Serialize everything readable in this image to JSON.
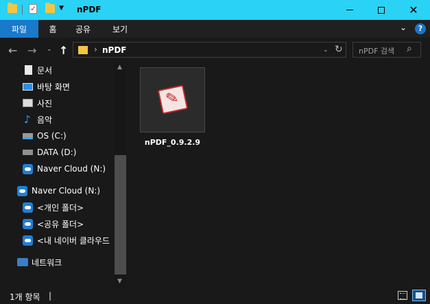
{
  "window": {
    "title": "nPDF",
    "minimize_icon": "minimize-icon",
    "maximize_icon": "maximize-icon",
    "close_glyph": "✕"
  },
  "ribbon": {
    "tabs": [
      "파일",
      "홈",
      "공유",
      "보기"
    ],
    "collapse_glyph": "⌄",
    "help_glyph": "?"
  },
  "address": {
    "back_glyph": "←",
    "forward_glyph": "→",
    "recent_glyph": "⌄",
    "up_glyph": "↑",
    "separator": "›",
    "path": "nPDF",
    "dropdown_glyph": "⌄",
    "refresh_glyph": "↻"
  },
  "search": {
    "placeholder": "nPDF 검색",
    "icon_glyph": "⌕"
  },
  "nav": {
    "items": [
      {
        "label": "문서",
        "icon": "documents-icon"
      },
      {
        "label": "바탕 화면",
        "icon": "desktop-icon"
      },
      {
        "label": "사진",
        "icon": "pictures-icon"
      },
      {
        "label": "음악",
        "icon": "music-icon"
      },
      {
        "label": "OS (C:)",
        "icon": "os-drive-icon"
      },
      {
        "label": "DATA (D:)",
        "icon": "drive-icon"
      },
      {
        "label": "Naver Cloud (N:)",
        "icon": "naver-cloud-icon"
      },
      {
        "label": "Naver Cloud (N:)",
        "icon": "naver-cloud-icon"
      },
      {
        "label": "<개인 폴더>",
        "icon": "naver-cloud-folder-icon"
      },
      {
        "label": "<공유 폴더>",
        "icon": "naver-cloud-folder-icon"
      },
      {
        "label": "<내 네이버 클라우드",
        "icon": "naver-cloud-info-icon"
      },
      {
        "label": "네트워크",
        "icon": "network-icon"
      }
    ],
    "music_glyph": "♪"
  },
  "scrollbar": {
    "up_glyph": "▲",
    "down_glyph": "▼"
  },
  "files": [
    {
      "name": "nPDF_0.9.2.9",
      "icon": "npdf-app-icon"
    }
  ],
  "status": {
    "item_count": "1개 항목",
    "separator": "|"
  },
  "colors": {
    "titlebar": "#2ad2f5",
    "file_tab": "#1979ca",
    "background": "#191919"
  }
}
